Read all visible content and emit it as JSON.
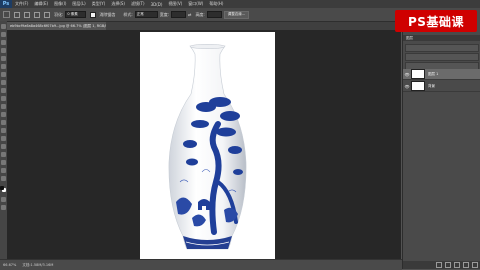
{
  "menubar": {
    "logo": "Ps",
    "items": [
      "文件(F)",
      "编辑(E)",
      "图像(I)",
      "图层(L)",
      "类型(Y)",
      "选择(S)",
      "滤镜(T)",
      "3D(D)",
      "视图(V)",
      "窗口(W)",
      "帮助(H)"
    ]
  },
  "options": {
    "feather_label": "羽化:",
    "feather_value": "0 像素",
    "antialias_label": "消除锯齿",
    "style_label": "样式:",
    "style_value": "正常",
    "width_label": "宽度:",
    "height_label": "高度:",
    "refine_label": "调整边缘..."
  },
  "document": {
    "tab_title": "eb9bcf9a6a8a468c6f07b9...jpg @ 66.7% (图层 1, RGB/8)"
  },
  "status": {
    "zoom": "66.67%",
    "doc_info": "文档:1.58M/3.16M"
  },
  "badge": {
    "text": "PS基础课"
  },
  "layers_panel": {
    "header": "图层",
    "layers": [
      {
        "name": "图层 1",
        "selected": true
      },
      {
        "name": "背景",
        "selected": false
      }
    ]
  },
  "colors": {
    "badge_bg": "#cf0000",
    "canvas_bg": "#272727",
    "panel_bg": "#4a4a4a",
    "porcelain_blue": "#1f3f9a"
  }
}
